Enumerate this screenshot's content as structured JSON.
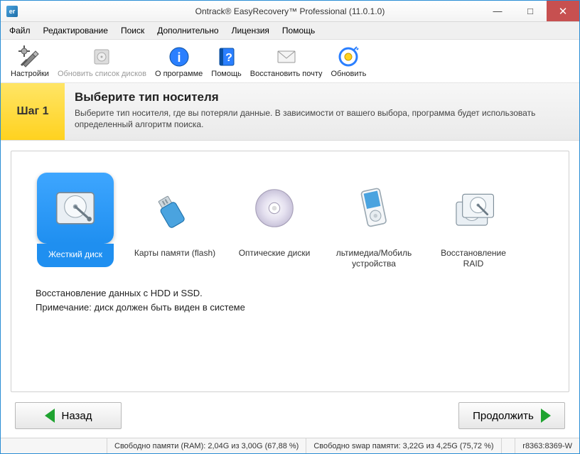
{
  "titlebar": {
    "icon_text": "er",
    "title": "Ontrack® EasyRecovery™ Professional (11.0.1.0)"
  },
  "menu": [
    "Файл",
    "Редактирование",
    "Поиск",
    "Дополнительно",
    "Лицензия",
    "Помощь"
  ],
  "toolbar": {
    "settings": "Настройки",
    "refresh_disks": "Обновить список дисков",
    "about": "О программе",
    "help": "Помощь",
    "recover_mail": "Восстановить почту",
    "update": "Обновить"
  },
  "step": {
    "badge": "Шаг 1",
    "title": "Выберите тип носителя",
    "subtitle": "Выберите тип носителя, где вы потеряли данные. В зависимости от вашего выбора, программа будет использовать определенный алгоритм поиска."
  },
  "media": {
    "hdd": "Жесткий диск",
    "flash": "Карты памяти (flash)",
    "optical": "Оптические диски",
    "mobile": "льтимедиа/Мобиль устройства",
    "raid": "Восстановление RAID"
  },
  "description": {
    "line1": "Восстановление данных c HDD и SSD.",
    "line2": " Примечание: диск должен быть виден в системе"
  },
  "nav": {
    "back": "Назад",
    "next": "Продолжить"
  },
  "status": {
    "ram": "Свободно памяти (RAM): 2,04G из 3,00G (67,88 %)",
    "swap": "Свободно swap памяти: 3,22G из 4,25G (75,72 %)",
    "build": "r8363:8369-W"
  }
}
